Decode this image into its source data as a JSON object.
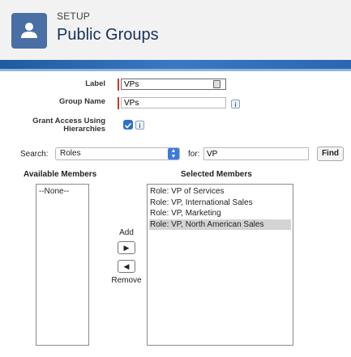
{
  "header": {
    "setup": "SETUP",
    "title": "Public Groups",
    "icon": "people-icon"
  },
  "form": {
    "label_label": "Label",
    "label_value": "VPs",
    "group_name_label": "Group Name",
    "group_name_value": "VPs",
    "grant_access_label_1": "Grant Access Using",
    "grant_access_label_2": "Hierarchies",
    "grant_access_checked": true
  },
  "search": {
    "label": "Search:",
    "selected": "Roles",
    "for_label": "for:",
    "for_value": "VP",
    "find_label": "Find"
  },
  "available": {
    "title": "Available Members",
    "items": [
      "--None--"
    ]
  },
  "selected": {
    "title": "Selected Members",
    "items": [
      "Role: VP of Services",
      "Role: VP, International Sales",
      "Role: VP, Marketing",
      "Role: VP, North American Sales"
    ],
    "highlighted_index": 3
  },
  "actions": {
    "add": "Add",
    "remove": "Remove"
  },
  "colors": {
    "header_icon_bg": "#4a6fa5",
    "title": "#16325c",
    "band": "#2a67b0",
    "required": "#c23934"
  }
}
